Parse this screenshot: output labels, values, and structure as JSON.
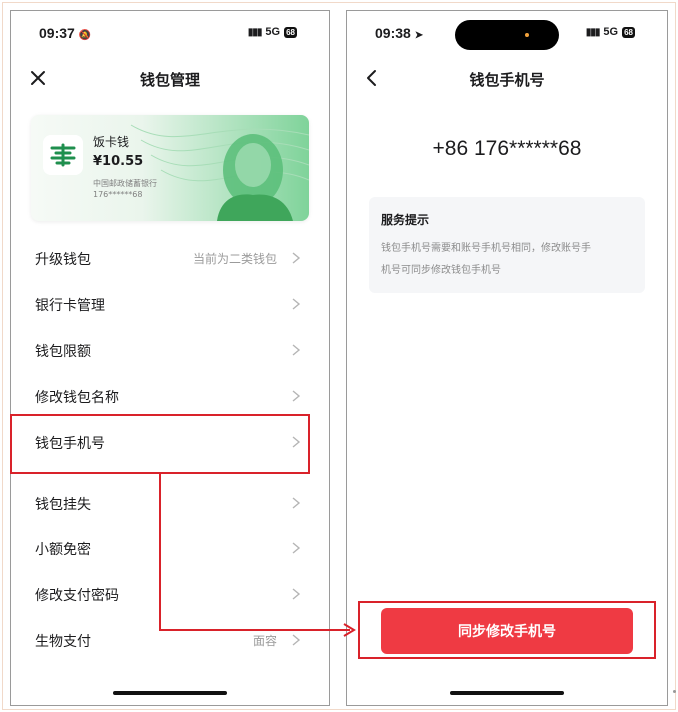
{
  "left_screen": {
    "status": {
      "time": "09:37",
      "network": "5G",
      "battery": "68"
    },
    "nav": {
      "title": "钱包管理",
      "close_icon": "close-icon"
    },
    "card": {
      "name": "饭卡钱",
      "amount": "¥10.55",
      "bank": "中国邮政储蓄银行",
      "account": "176******68"
    },
    "menu": [
      {
        "label": "升级钱包",
        "value": "当前为二类钱包"
      },
      {
        "label": "银行卡管理",
        "value": ""
      },
      {
        "label": "钱包限额",
        "value": ""
      },
      {
        "label": "修改钱包名称",
        "value": ""
      },
      {
        "label": "钱包手机号",
        "value": ""
      },
      {
        "label": "钱包挂失",
        "value": ""
      },
      {
        "label": "小额免密",
        "value": ""
      },
      {
        "label": "修改支付密码",
        "value": ""
      },
      {
        "label": "生物支付",
        "value": "面容"
      }
    ]
  },
  "right_screen": {
    "status": {
      "time": "09:38",
      "network": "5G",
      "battery": "68"
    },
    "nav": {
      "title": "钱包手机号",
      "back_icon": "back-chevron-icon"
    },
    "phone_number": "+86 176******68",
    "notice": {
      "title": "服务提示",
      "line1": "钱包手机号需要和账号手机号相同，修改账号手",
      "line2": "机号可同步修改钱包手机号"
    },
    "primary_button": "同步修改手机号"
  },
  "colors": {
    "accent_red": "#ef3a43",
    "annotation_red": "#d9222a",
    "card_green": "#3fa65b",
    "postal_green": "#1f8f4e"
  }
}
